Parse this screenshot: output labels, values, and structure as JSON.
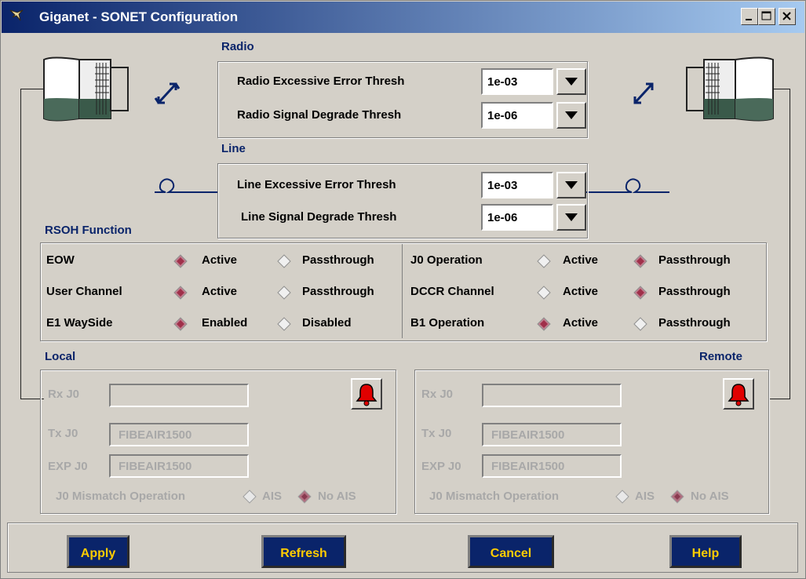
{
  "window": {
    "title": "Giganet - SONET Configuration"
  },
  "radio": {
    "section_label": "Radio",
    "rows": [
      {
        "label": "Radio Excessive Error Thresh",
        "value": "1e-03"
      },
      {
        "label": "Radio Signal Degrade Thresh",
        "value": "1e-06"
      }
    ]
  },
  "line": {
    "section_label": "Line",
    "rows": [
      {
        "label": "Line Excessive Error Thresh",
        "value": "1e-03"
      },
      {
        "label": "Line Signal Degrade Thresh",
        "value": "1e-06"
      }
    ]
  },
  "rsoh": {
    "section_label": "RSOH Function",
    "left": [
      {
        "name": "EOW",
        "opt1": "Active",
        "opt2": "Passthrough",
        "selected": 1
      },
      {
        "name": "User Channel",
        "opt1": "Active",
        "opt2": "Passthrough",
        "selected": 1
      },
      {
        "name": "E1 WaySide",
        "opt1": "Enabled",
        "opt2": "Disabled",
        "selected": 1
      }
    ],
    "right": [
      {
        "name": "J0 Operation",
        "opt1": "Active",
        "opt2": "Passthrough",
        "selected": 2
      },
      {
        "name": "DCCR Channel",
        "opt1": "Active",
        "opt2": "Passthrough",
        "selected": 2
      },
      {
        "name": "B1 Operation",
        "opt1": "Active",
        "opt2": "Passthrough",
        "selected": 1
      }
    ]
  },
  "local": {
    "section_label": "Local",
    "rx_label": "Rx J0",
    "rx_value": "",
    "tx_label": "Tx J0",
    "tx_value": "FIBEAIR1500",
    "exp_label": "EXP J0",
    "exp_value": "FIBEAIR1500",
    "mismatch_label": "J0 Mismatch Operation",
    "ais": "AIS",
    "no_ais": "No AIS",
    "selected": "No AIS"
  },
  "remote": {
    "section_label": "Remote",
    "rx_label": "Rx J0",
    "rx_value": "",
    "tx_label": "Tx J0",
    "tx_value": "FIBEAIR1500",
    "exp_label": "EXP J0",
    "exp_value": "FIBEAIR1500",
    "mismatch_label": "J0 Mismatch Operation",
    "ais": "AIS",
    "no_ais": "No AIS",
    "selected": "No AIS"
  },
  "buttons": {
    "apply": "Apply",
    "refresh": "Refresh",
    "cancel": "Cancel",
    "help": "Help"
  },
  "colors": {
    "accent": "#0a246a",
    "button_text": "#ffcc00",
    "radio_selected": "#a0304a"
  }
}
